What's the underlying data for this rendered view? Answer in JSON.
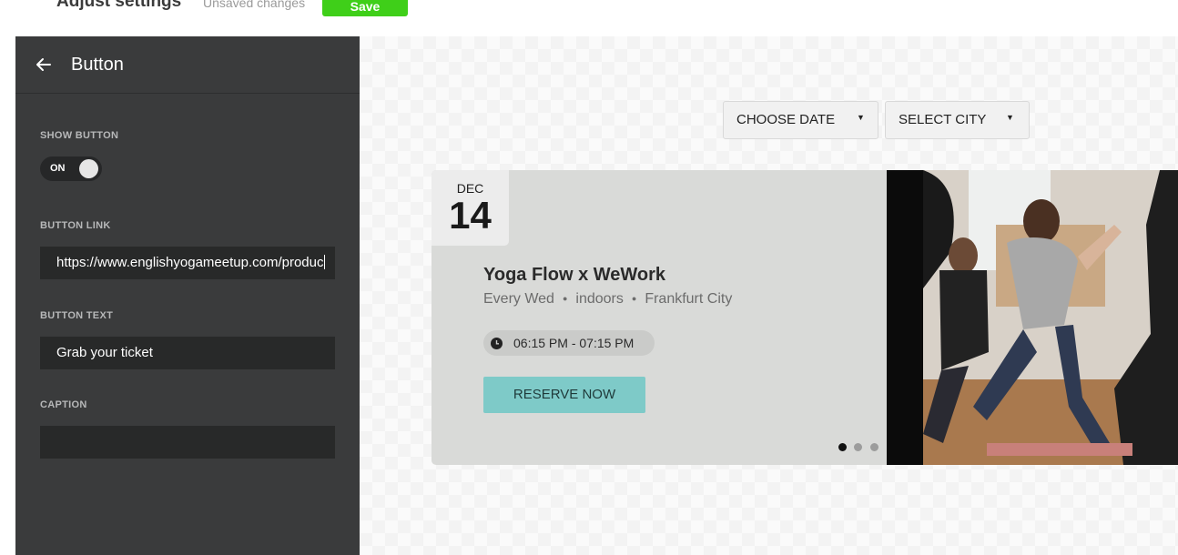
{
  "topbar": {
    "title": "Adjust settings",
    "status": "Unsaved changes",
    "save_label": "Save"
  },
  "sidebar": {
    "title": "Button",
    "show_button": {
      "label": "SHOW BUTTON",
      "toggle_text": "ON",
      "on": true
    },
    "button_link": {
      "label": "BUTTON LINK",
      "value": "https://www.englishyogameetup.com/produc"
    },
    "button_text": {
      "label": "BUTTON TEXT",
      "value": "Grab your ticket"
    },
    "caption": {
      "label": "CAPTION",
      "value": ""
    }
  },
  "preview": {
    "filters": {
      "date_label": "CHOOSE DATE",
      "city_label": "SELECT CITY"
    },
    "event": {
      "month": "DEC",
      "day": "14",
      "title": "Yoga Flow x WeWork",
      "frequency": "Every Wed",
      "setting": "indoors",
      "city": "Frankfurt City",
      "time": "06:15 PM - 07:15 PM",
      "cta": "RESERVE NOW",
      "slide_count": 3,
      "active_slide": 1
    }
  },
  "colors": {
    "save": "#3fcf19",
    "sidebar_bg": "#3a3b3c",
    "card_bg": "#d9dad8",
    "cta_bg": "#7ecac8"
  }
}
